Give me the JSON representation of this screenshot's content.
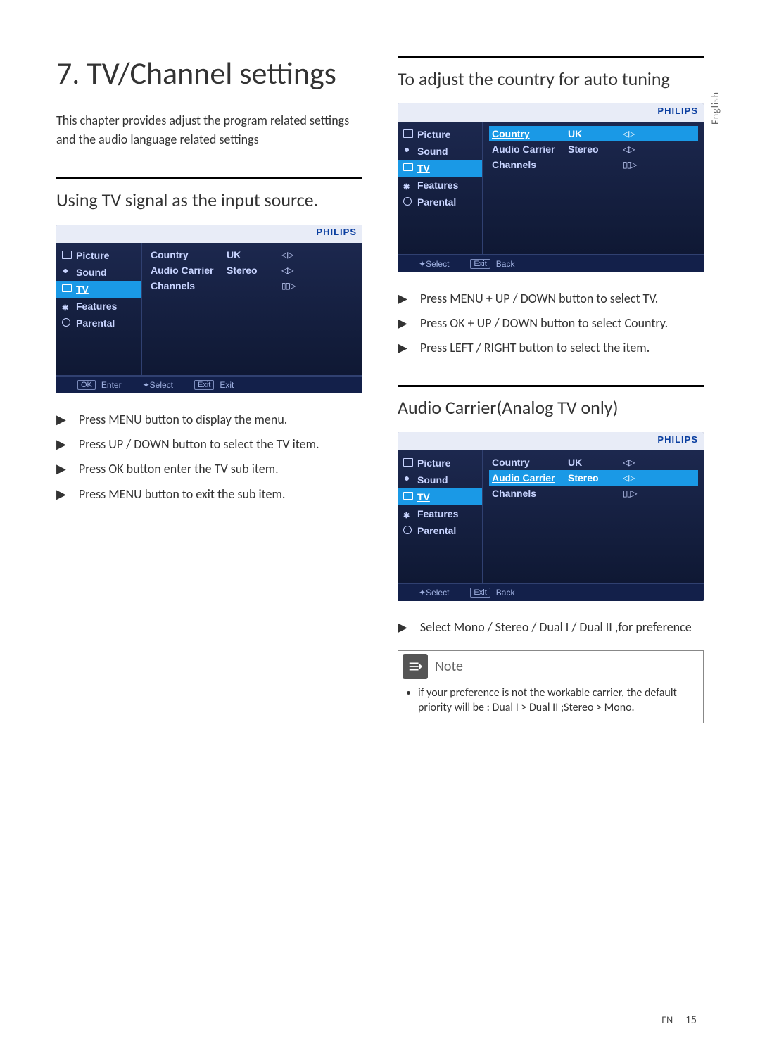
{
  "language_tab": "English",
  "chapter_title": "7.  TV/Channel settings",
  "intro": "This chapter provides adjust the program related settings and the audio language related settings",
  "section1_title": "Using TV signal as the input source.",
  "section2_title": "To adjust the country for auto tuning",
  "section3_title": "Audio Carrier(Analog TV only)",
  "brand": "PHILIPS",
  "osd_common": {
    "side_items": [
      {
        "label": "Picture",
        "icon": "ico-pic"
      },
      {
        "label": "Sound",
        "icon": "ico-snd"
      },
      {
        "label": "TV",
        "icon": "ico-tv"
      },
      {
        "label": "Features",
        "icon": "ico-feat"
      },
      {
        "label": "Parental",
        "icon": "ico-par"
      }
    ]
  },
  "osd1": {
    "active_side": "TV",
    "rows": [
      {
        "label": "Country",
        "value": "UK",
        "nav": "◁▷"
      },
      {
        "label": "Audio Carrier",
        "value": "Stereo",
        "nav": "◁▷"
      },
      {
        "label": "Channels",
        "value": "",
        "nav": "▯▯▷"
      }
    ],
    "selected_row": -1,
    "footer": [
      {
        "btn": "OK",
        "label": "Enter"
      },
      {
        "btn_nav4": true,
        "label": "Select"
      },
      {
        "btn": "Exit",
        "label": "Exit"
      }
    ]
  },
  "osd2": {
    "active_side": "TV",
    "rows": [
      {
        "label": "Country",
        "value": "UK",
        "nav": "◁▷"
      },
      {
        "label": "Audio Carrier",
        "value": "Stereo",
        "nav": "◁▷"
      },
      {
        "label": "Channels",
        "value": "",
        "nav": "▯▯▷"
      }
    ],
    "selected_row": 0,
    "footer": [
      {
        "btn_nav4": true,
        "label": "Select"
      },
      {
        "btn": "Exit",
        "label": "Back"
      }
    ]
  },
  "osd3": {
    "active_side": "TV",
    "rows": [
      {
        "label": "Country",
        "value": "UK",
        "nav": "◁▷"
      },
      {
        "label": "Audio Carrier",
        "value": "Stereo",
        "nav": "◁▷"
      },
      {
        "label": "Channels",
        "value": "",
        "nav": "▯▯▷"
      }
    ],
    "selected_row": 1,
    "footer": [
      {
        "btn_nav4": true,
        "label": "Select"
      },
      {
        "btn": "Exit",
        "label": "Back"
      }
    ]
  },
  "steps1": [
    "Press MENU button to display the menu.",
    "Press UP / DOWN button to select the TV item.",
    "Press OK button enter the TV sub item.",
    "Press MENU button to exit the sub item."
  ],
  "steps2": [
    "Press MENU + UP / DOWN button to select TV.",
    "Press OK + UP / DOWN button to select Country.",
    "Press LEFT / RIGHT button to select the item."
  ],
  "steps3": [
    "Select Mono / Stereo / Dual I / Dual II ,for preference"
  ],
  "note_title": "Note",
  "note_items": [
    "if your preference is not the workable carrier, the default priority will be : Dual I > Dual II ;Stereo > Mono."
  ],
  "page_lang": "EN",
  "page_num": "15"
}
